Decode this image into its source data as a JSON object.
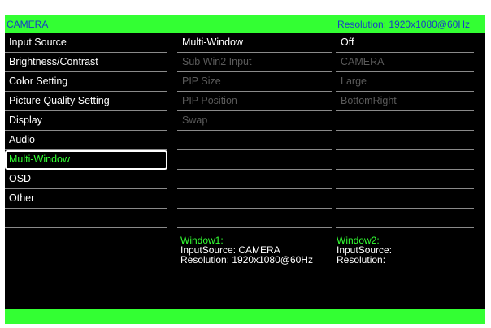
{
  "header": {
    "title": "CAMERA",
    "resolution": "Resolution: 1920x1080@60Hz"
  },
  "menu": [
    "Input Source",
    "Brightness/Contrast",
    "Color Setting",
    "Picture Quality Setting",
    "Display",
    "Audio",
    "Multi-Window",
    "OSD",
    "Other"
  ],
  "selected_menu": "Multi-Window",
  "settings": [
    {
      "label": "Multi-Window",
      "value": "Off"
    },
    {
      "label": "Sub Win2 Input",
      "value": "CAMERA"
    },
    {
      "label": "PIP Size",
      "value": "Large"
    },
    {
      "label": "PIP Position",
      "value": "BottomRight"
    },
    {
      "label": "Swap",
      "value": ""
    }
  ],
  "window1": {
    "title": "Window1:",
    "input": "InputSource: CAMERA",
    "resolution": "Resolution: 1920x1080@60Hz"
  },
  "window2": {
    "title": "Window2:",
    "input": "InputSource:",
    "resolution": "Resolution:"
  },
  "colors": {
    "accent": "#33ff33",
    "header_text": "#1a3cc8",
    "background": "#000000",
    "disabled_text": "#5a5a5a"
  }
}
